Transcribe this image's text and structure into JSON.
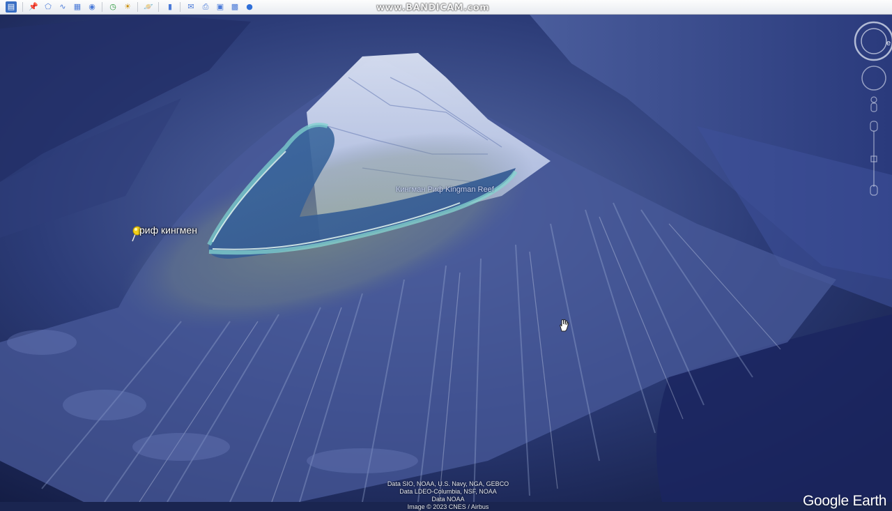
{
  "toolbar": {
    "icons": [
      "sidebar-toggle-icon",
      "placemark-icon",
      "polygon-icon",
      "path-icon",
      "image-overlay-icon",
      "record-tour-icon",
      "historical-imagery-icon",
      "sunlight-icon",
      "planets-icon",
      "ruler-icon",
      "email-icon",
      "print-icon",
      "save-image-icon",
      "view-in-maps-icon"
    ]
  },
  "watermark": "www.BANDICAM.com",
  "map": {
    "reef_label": "Кингман Риф Kingman Reef",
    "placemark_label": "риф кингмен",
    "north_indicator": "е",
    "attribution": [
      "Data SIO, NOAA, U.S. Navy, NGA, GEBCO",
      "Data LDEO-Columbia, NSF, NOAA",
      "Data NOAA",
      "Image © 2023 CNES / Airbus"
    ],
    "logo": "Google Earth"
  },
  "colors": {
    "ocean_deep": "#1a2550",
    "seafloor_light": "#9fb0d8",
    "lagoon": "#5aa6c0",
    "pin": "#f3d21a"
  }
}
